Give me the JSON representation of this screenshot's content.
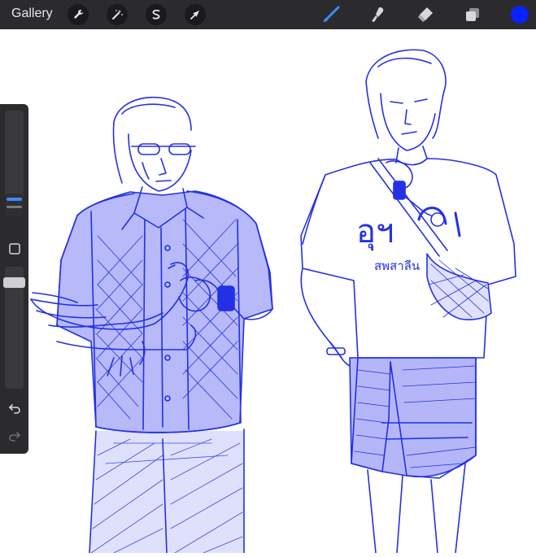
{
  "toolbar": {
    "gallery_label": "Gallery",
    "left_tools": [
      {
        "icon": "wrench-icon",
        "name": "actions"
      },
      {
        "icon": "magic-wand-icon",
        "name": "adjustments"
      },
      {
        "icon": "selection-icon",
        "name": "selection"
      },
      {
        "icon": "arrow-cursor-icon",
        "name": "transform"
      }
    ],
    "right_tools": [
      {
        "icon": "brush-icon",
        "name": "paint",
        "active": true
      },
      {
        "icon": "smudge-icon",
        "name": "smudge",
        "active": false
      },
      {
        "icon": "eraser-icon",
        "name": "eraser",
        "active": false
      },
      {
        "icon": "layers-icon",
        "name": "layers",
        "active": false
      }
    ],
    "current_color": "#0a22ff",
    "accent_color": "#3d8bff"
  },
  "sidebar": {
    "brush_size_level": 0.72,
    "opacity_level": 0.92,
    "modify_icon": "square-icon",
    "undo_icon": "undo-icon",
    "redo_icon": "redo-icon"
  },
  "canvas": {
    "ink_color": "#2430e6",
    "fill_color": "#6f73f2",
    "shirt_text": "อุฯ",
    "shirt_subtext": "สพสาลีน"
  }
}
